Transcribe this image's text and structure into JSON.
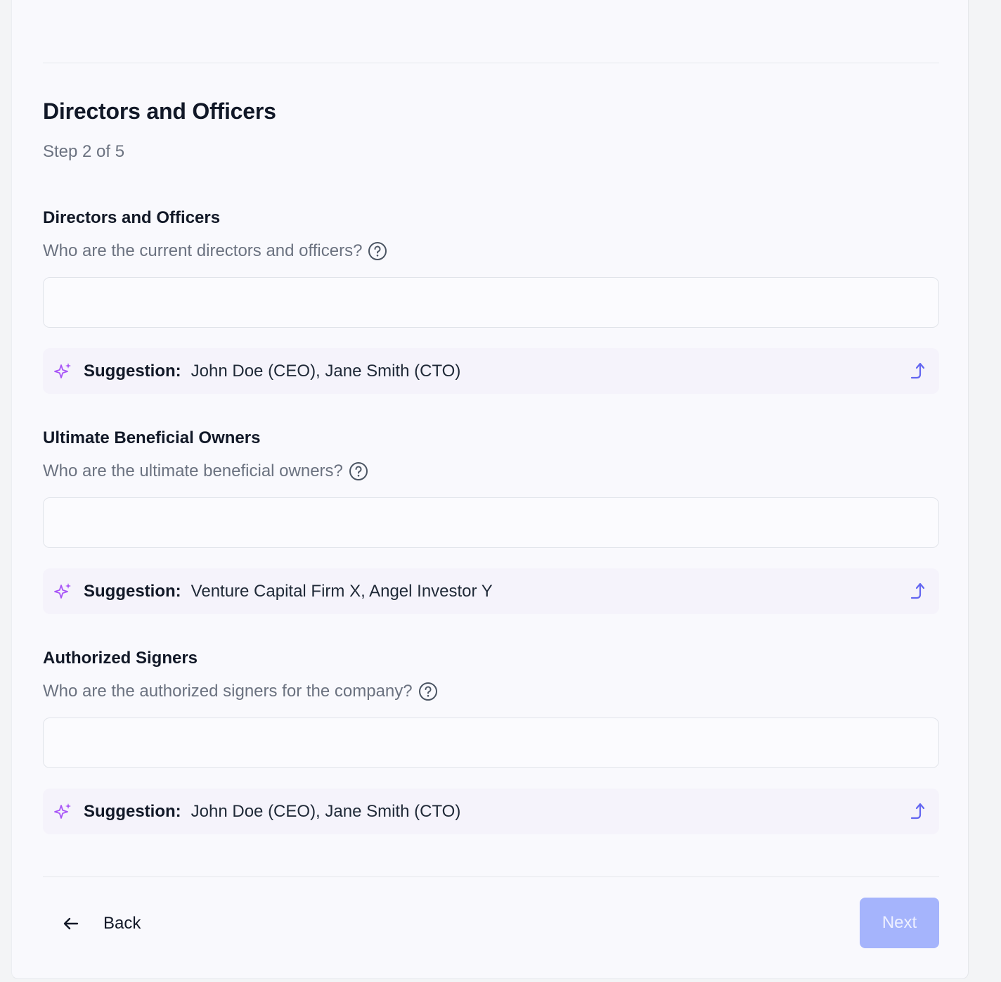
{
  "header": {
    "title": "Directors and Officers",
    "step": "Step 2 of 5"
  },
  "sections": [
    {
      "title": "Directors and Officers",
      "question": "Who are the current directors and officers?",
      "input_value": "",
      "suggestion_label": "Suggestion:",
      "suggestion_value": "John Doe (CEO), Jane Smith (CTO)"
    },
    {
      "title": "Ultimate Beneficial Owners",
      "question": "Who are the ultimate beneficial owners?",
      "input_value": "",
      "suggestion_label": "Suggestion:",
      "suggestion_value": "Venture Capital Firm X, Angel Investor Y"
    },
    {
      "title": "Authorized Signers",
      "question": "Who are the authorized signers for the company?",
      "input_value": "",
      "suggestion_label": "Suggestion:",
      "suggestion_value": "John Doe (CEO), Jane Smith (CTO)"
    }
  ],
  "footer": {
    "back_label": "Back",
    "next_label": "Next"
  },
  "icons": {
    "help": "question-circle-icon",
    "suggestion": "sparkle-icon",
    "apply": "arrow-up-apply-icon",
    "back": "arrow-left-icon"
  },
  "colors": {
    "accent": "#a5b4fc",
    "sparkle": "#a855f7",
    "apply": "#6366f1"
  }
}
